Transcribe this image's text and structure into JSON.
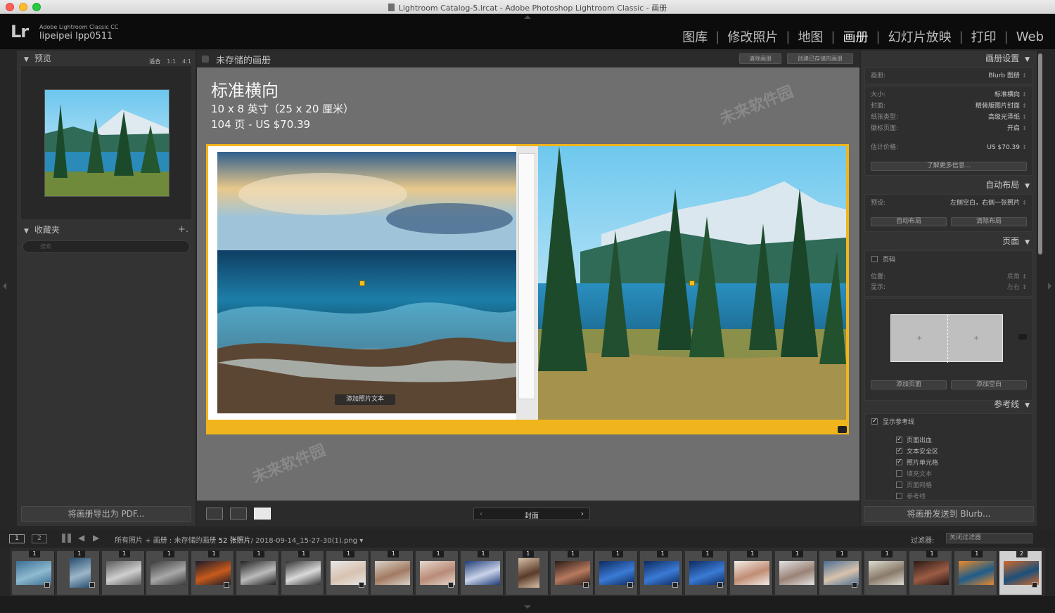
{
  "window": {
    "title": "Lightroom Catalog-5.lrcat - Adobe Photoshop Lightroom Classic - 画册"
  },
  "identity": {
    "logo": "Lr",
    "product": "Adobe Lightroom Classic CC",
    "user": "lipeipei lpp0511"
  },
  "modules": [
    {
      "label": "图库",
      "active": false
    },
    {
      "label": "修改照片",
      "active": false
    },
    {
      "label": "地图",
      "active": false
    },
    {
      "label": "画册",
      "active": true
    },
    {
      "label": "幻灯片放映",
      "active": false
    },
    {
      "label": "打印",
      "active": false
    },
    {
      "label": "Web",
      "active": false
    }
  ],
  "left": {
    "preview_header": "预览",
    "zoom": [
      "适合",
      "1:1",
      "4:1"
    ],
    "collections_header": "收藏夹",
    "collections_add": "+.",
    "search_placeholder": "搜索",
    "export_button": "将画册导出为 PDF..."
  },
  "center": {
    "book_name": "未存储的画册",
    "clear_button": "清除画册",
    "create_button": "创建已存储的画册",
    "book_title": "标准横向",
    "book_size": "10 x 8 英寸（25 x 20 厘米）",
    "book_pages_price": "104 页 - US $70.39",
    "add_caption": "添加照片文本",
    "page_nav_label": "封面",
    "watermark": "未来软件园"
  },
  "right": {
    "settings": {
      "header": "画册设置",
      "book_label": "画册:",
      "book_value": "Blurb 图册",
      "size_label": "大小:",
      "size_value": "标准横向",
      "cover_label": "封面:",
      "cover_value": "精装版图片封面",
      "paper_label": "纸张类型:",
      "paper_value": "高级光泽纸",
      "logo_label": "徽标页面:",
      "logo_value": "开启",
      "price_label": "估计价格:",
      "price_value": "US $70.39",
      "more_info": "了解更多信息..."
    },
    "autolayout": {
      "header": "自动布局",
      "preset_label": "预设:",
      "preset_value": "左侧空白，右侧一张照片",
      "auto_button": "自动布局",
      "clear_button": "清除布局"
    },
    "page": {
      "header": "页面",
      "page_number": "页码",
      "position_label": "位置:",
      "position_value": "底角",
      "display_label": "显示:",
      "display_value": "左右",
      "add_page": "添加页面",
      "add_blank": "添加空白"
    },
    "guides": {
      "header": "参考线",
      "show": "显示参考线",
      "items": [
        {
          "label": "页面出血",
          "checked": true
        },
        {
          "label": "文本安全区",
          "checked": true
        },
        {
          "label": "照片单元格",
          "checked": true
        },
        {
          "label": "填充文本",
          "checked": false
        },
        {
          "label": "页面网格",
          "checked": false
        },
        {
          "label": "参考线",
          "checked": false
        }
      ]
    },
    "send_button": "将画册发送到 Blurb..."
  },
  "filmstrip_bar": {
    "monitor_1": "1",
    "monitor_2": "2",
    "source_all": "所有照片",
    "source_book": "画册 : 未存储的画册",
    "count": "52 张照片",
    "filename": "/ 2018-09-14_15-27-30(1).png",
    "filter_label": "过滤器:",
    "filter_value": "关闭过滤器"
  },
  "filmstrip": {
    "badges": [
      "1",
      "1",
      "1",
      "1",
      "1",
      "1",
      "1",
      "1",
      "1",
      "1",
      "1",
      "1",
      "1",
      "1",
      "1",
      "1",
      "1",
      "1",
      "1",
      "1",
      "1",
      "1",
      "2"
    ]
  }
}
